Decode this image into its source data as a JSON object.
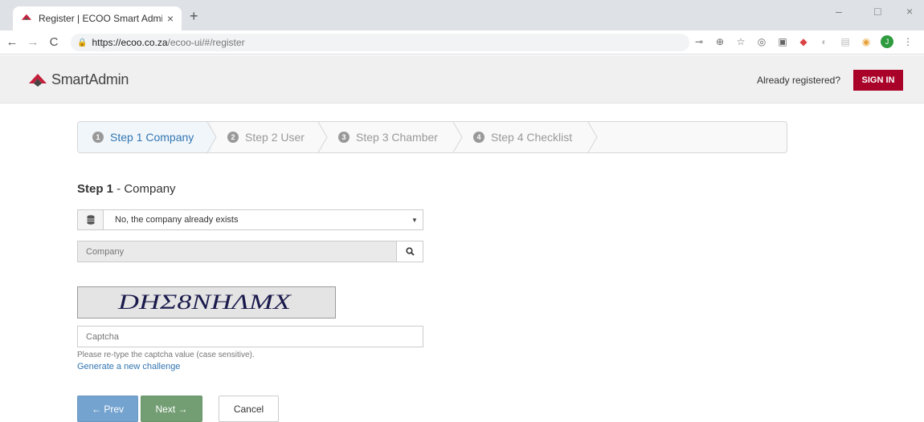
{
  "browser": {
    "tab_title": "Register | ECOO Smart Admin",
    "tab_close": "×",
    "new_tab": "+",
    "url_host": "https://ecoo.co.za",
    "url_rest": "/ecoo-ui/#/register",
    "profile_initial": "J",
    "minimize": "–",
    "maximize": "□",
    "close": "×"
  },
  "header": {
    "logo_text": "SmartAdmin",
    "already_registered": "Already registered?",
    "sign_in": "SIGN IN",
    "brand_color": "#a90329"
  },
  "wizard": {
    "steps": [
      {
        "num": "1",
        "label": "Step 1 Company",
        "active": true
      },
      {
        "num": "2",
        "label": "Step 2 User",
        "active": false
      },
      {
        "num": "3",
        "label": "Step 3 Chamber",
        "active": false
      },
      {
        "num": "4",
        "label": "Step 4 Checklist",
        "active": false
      }
    ]
  },
  "form": {
    "title_bold": "Step 1",
    "title_rest": " - Company",
    "company_exists_value": "No, the company already exists",
    "company_placeholder": "Company",
    "captcha_text": "DHΣ8NHΛMX",
    "captcha_placeholder": "Captcha",
    "help_text": "Please re-type the captcha value (case sensitive).",
    "generate_link": "Generate a new challenge"
  },
  "buttons": {
    "prev": "← Prev",
    "next": "Next →",
    "cancel": "Cancel"
  }
}
